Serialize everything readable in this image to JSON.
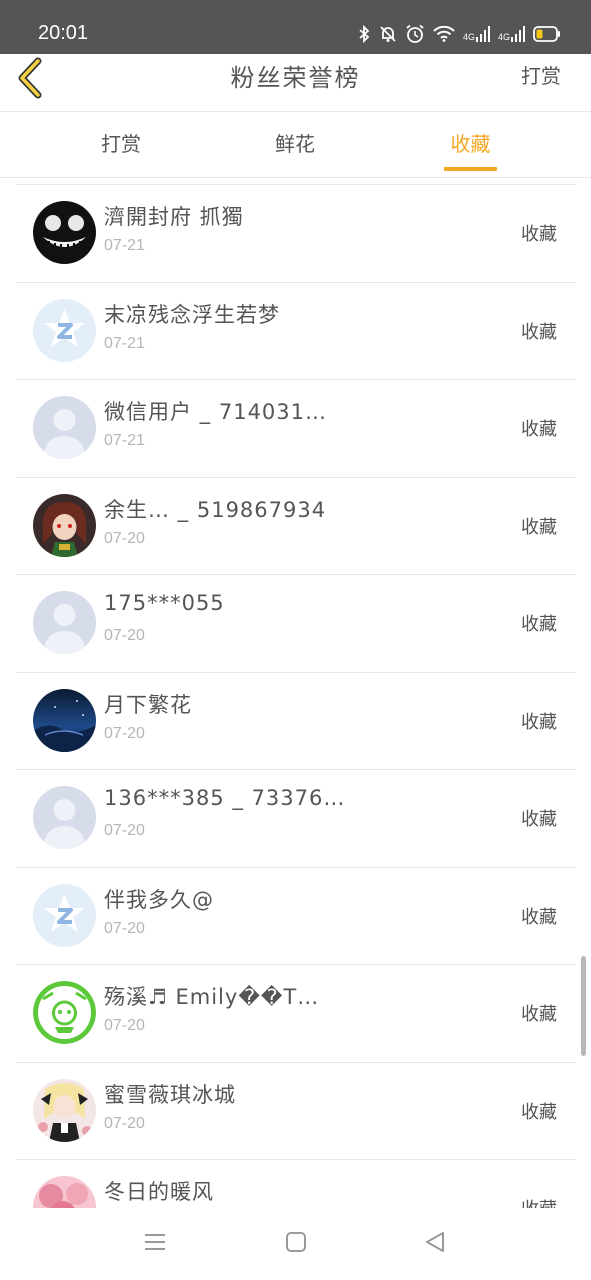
{
  "status_bar": {
    "time": "20:01",
    "network1": "4G",
    "network2": "4G"
  },
  "header": {
    "title": "粉丝荣誉榜",
    "action_label": "打赏"
  },
  "tabs": [
    {
      "label": "打赏",
      "active": false
    },
    {
      "label": "鲜花",
      "active": false
    },
    {
      "label": "收藏",
      "active": true
    }
  ],
  "accent_color": "#F5A623",
  "list": {
    "items": [
      {
        "name": "濟開封府 抓獨",
        "date": "07-21",
        "action": "收藏",
        "avatar": "black-smiley-face"
      },
      {
        "name": "末凉残念浮生若梦",
        "date": "07-21",
        "action": "收藏",
        "avatar": "default-z-star"
      },
      {
        "name": "微信用户 _ 714031…",
        "date": "07-21",
        "action": "收藏",
        "avatar": "default-person"
      },
      {
        "name": "余生… _ 519867934",
        "date": "07-20",
        "action": "收藏",
        "avatar": "anime-girl-red"
      },
      {
        "name": "175***055",
        "date": "07-20",
        "action": "收藏",
        "avatar": "default-person"
      },
      {
        "name": "月下繁花",
        "date": "07-20",
        "action": "收藏",
        "avatar": "night-landscape"
      },
      {
        "name": "136***385 _ 73376…",
        "date": "07-20",
        "action": "收藏",
        "avatar": "default-person"
      },
      {
        "name": "伴我多久@",
        "date": "07-20",
        "action": "收藏",
        "avatar": "default-z-star"
      },
      {
        "name": "殇溪♬ Emily��T…",
        "date": "07-20",
        "action": "收藏",
        "avatar": "green-badge"
      },
      {
        "name": "蜜雪薇琪冰城",
        "date": "07-20",
        "action": "收藏",
        "avatar": "anime-doll"
      },
      {
        "name": "冬日的暖风",
        "date": "",
        "action": "收藏",
        "avatar": "pink-roses"
      }
    ]
  },
  "nav_bar": {
    "icons": [
      "menu-icon",
      "home-square-icon",
      "back-triangle-icon"
    ]
  }
}
